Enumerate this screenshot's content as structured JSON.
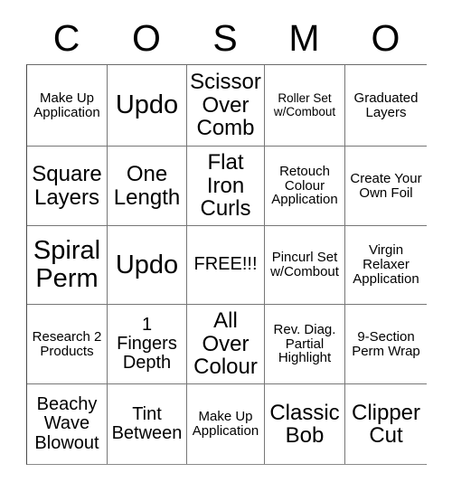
{
  "card": {
    "header_letters": [
      "C",
      "O",
      "S",
      "M",
      "O"
    ],
    "columns": 5,
    "rows": 5,
    "free_space_index": 12,
    "colors": {
      "background": "#ffffff",
      "text": "#000000",
      "grid_line": "#777777"
    },
    "cells": [
      {
        "text": "Make Up Application",
        "size": "sm"
      },
      {
        "text": "Updo",
        "size": "xl"
      },
      {
        "text": "Scissor Over Comb",
        "size": "lg"
      },
      {
        "text": "Roller Set w/Combout",
        "size": "xs"
      },
      {
        "text": "Graduated Layers",
        "size": "sm"
      },
      {
        "text": "Square Layers",
        "size": "lg"
      },
      {
        "text": "One Length",
        "size": "lg"
      },
      {
        "text": "Flat Iron Curls",
        "size": "lg"
      },
      {
        "text": "Retouch Colour Application",
        "size": "sm"
      },
      {
        "text": "Create Your Own Foil",
        "size": "sm"
      },
      {
        "text": "Spiral Perm",
        "size": "xl"
      },
      {
        "text": "Updo",
        "size": "xl"
      },
      {
        "text": "FREE!!!",
        "size": "md"
      },
      {
        "text": "Pincurl Set w/Combout",
        "size": "sm"
      },
      {
        "text": "Virgin Relaxer Application",
        "size": "sm"
      },
      {
        "text": "Research 2 Products",
        "size": "sm"
      },
      {
        "text": "1 Fingers Depth",
        "size": "md"
      },
      {
        "text": "All Over Colour",
        "size": "lg"
      },
      {
        "text": "Rev. Diag. Partial Highlight",
        "size": "sm"
      },
      {
        "text": "9-Section Perm Wrap",
        "size": "sm"
      },
      {
        "text": "Beachy Wave Blowout",
        "size": "md"
      },
      {
        "text": "Tint Between",
        "size": "md"
      },
      {
        "text": "Make Up Application",
        "size": "sm"
      },
      {
        "text": "Classic Bob",
        "size": "lg"
      },
      {
        "text": "Clipper Cut",
        "size": "lg"
      }
    ]
  }
}
